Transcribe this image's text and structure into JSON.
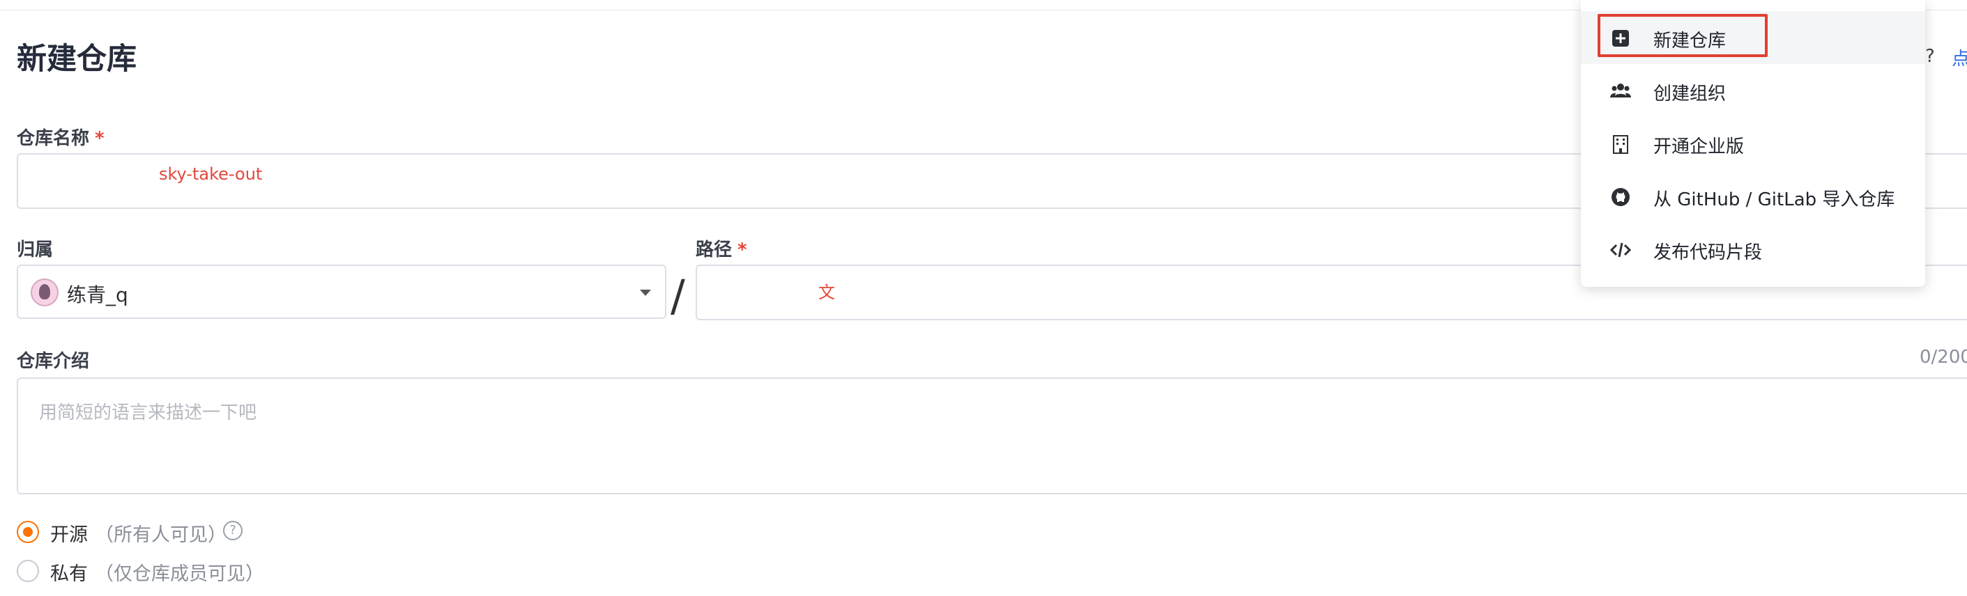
{
  "page": {
    "title": "新建仓库"
  },
  "form": {
    "repo_name": {
      "label": "仓库名称",
      "required_mark": "*",
      "value": "sky-take-out"
    },
    "owner": {
      "label": "归属",
      "value": "练青_q"
    },
    "separator": "/",
    "path": {
      "label": "路径",
      "required_mark": "*",
      "value": "文"
    },
    "description": {
      "label": "仓库介绍",
      "counter": "0/200",
      "placeholder": "用简短的语言来描述一下吧"
    },
    "visibility": {
      "options": [
        {
          "label": "开源",
          "hint": "（所有人可见）",
          "selected": true,
          "help_icon": "question-circle-icon"
        },
        {
          "label": "私有",
          "hint": "（仅仓库成员可见）",
          "selected": false
        }
      ]
    }
  },
  "header_right": {
    "question": "?",
    "link": "点"
  },
  "dropdown_menu": {
    "items": [
      {
        "label": "新建仓库",
        "icon": "plus-square-icon",
        "active": true
      },
      {
        "label": "创建组织",
        "icon": "users-icon",
        "active": false
      },
      {
        "label": "开通企业版",
        "icon": "building-icon",
        "active": false
      },
      {
        "label": "从 GitHub / GitLab 导入仓库",
        "icon": "github-icon",
        "active": false
      },
      {
        "label": "发布代码片段",
        "icon": "code-icon",
        "active": false
      }
    ]
  },
  "colors": {
    "accent_orange": "#fe7300",
    "required_red": "#e5483c",
    "highlight_red": "#e0402f",
    "link_blue": "#2f6de1"
  }
}
